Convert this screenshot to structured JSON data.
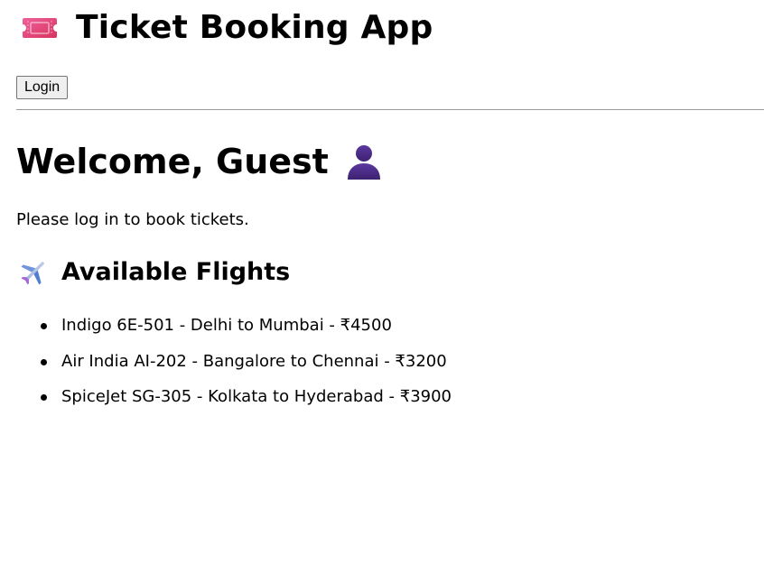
{
  "header": {
    "icon": "ticket-icon",
    "title": "Ticket Booking App"
  },
  "auth": {
    "login_label": "Login"
  },
  "welcome": {
    "title": "Welcome, Guest",
    "icon": "guest-user-icon",
    "prompt": "Please log in to book tickets."
  },
  "flights": {
    "icon": "airplane-icon",
    "title": "Available Flights",
    "items": [
      {
        "label": "Indigo 6E-501 - Delhi to Mumbai - ₹4500"
      },
      {
        "label": "Air India AI-202 - Bangalore to Chennai - ₹3200"
      },
      {
        "label": "SpiceJet SG-305 - Kolkata to Hyderabad - ₹3900"
      }
    ]
  },
  "colors": {
    "ticket_icon": "#e8467c",
    "user_icon": "#4a2c82",
    "plane_icon": "#7ea6e0",
    "divider": "#9a9a9a"
  }
}
